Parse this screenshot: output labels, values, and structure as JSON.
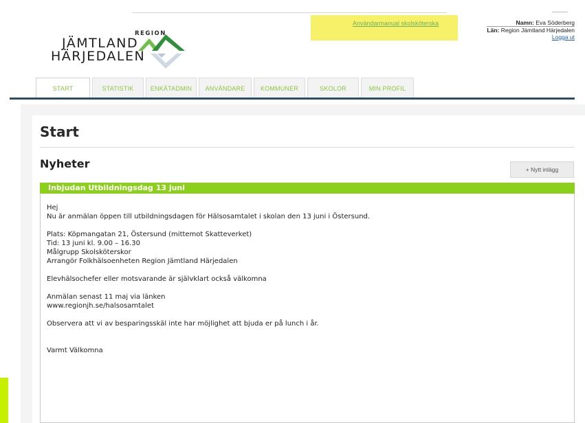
{
  "header": {
    "logo": {
      "region": "REGION",
      "line1": "JÄMTLAND",
      "line2": "HÄRJEDALEN"
    },
    "manual_link": "Användarmanual skolsköterska",
    "user": {
      "name_label": "Namn:",
      "name_value": "Eva Söderberg",
      "lan_label": "Län:",
      "lan_value": "Region Jämtland Härjedalen",
      "logout": "Logga ut"
    }
  },
  "nav": {
    "tabs": [
      {
        "label": "START",
        "active": true
      },
      {
        "label": "STATISTIK",
        "active": false
      },
      {
        "label": "ENKÄTADMIN",
        "active": false
      },
      {
        "label": "ANVÄNDARE",
        "active": false
      },
      {
        "label": "KOMMUNER",
        "active": false
      },
      {
        "label": "SKOLOR",
        "active": false
      },
      {
        "label": "MIN PROFIL",
        "active": false
      }
    ]
  },
  "main": {
    "page_title": "Start",
    "news_title": "Nyheter",
    "new_post_button": "+ Nytt inlägg",
    "news_item": {
      "title": "Inbjudan Utbildningsdag 13 juni",
      "lines": [
        "Hej",
        "Nu är anmälan öppen till utbildningsdagen för Hälsosamtalet i skolan den 13 juni i Östersund.",
        "",
        "Plats: Köpmangatan 21, Östersund (mittemot Skatteverket)",
        "Tid: 13 juni kl. 9.00 – 16.30",
        "Målgrupp Skolsköterskor",
        "Arrangör Folkhälsoenheten Region Jämtland Härjedalen",
        "",
        "Elevhälsochefer eller motsvarande är självklart också välkomna",
        "",
        "Anmälan senast 11 maj via länken",
        "www.regionjh.se/halsosamtalet",
        "",
        "Observera att vi av besparingsskäl inte har möjlighet att bjuda er på lunch i år.",
        "",
        "",
        "Varmt Välkomna"
      ]
    }
  },
  "colors": {
    "accent_green": "#8ccf1c",
    "nav_dark": "#2b4f6b",
    "highlight": "#f7f16a"
  }
}
